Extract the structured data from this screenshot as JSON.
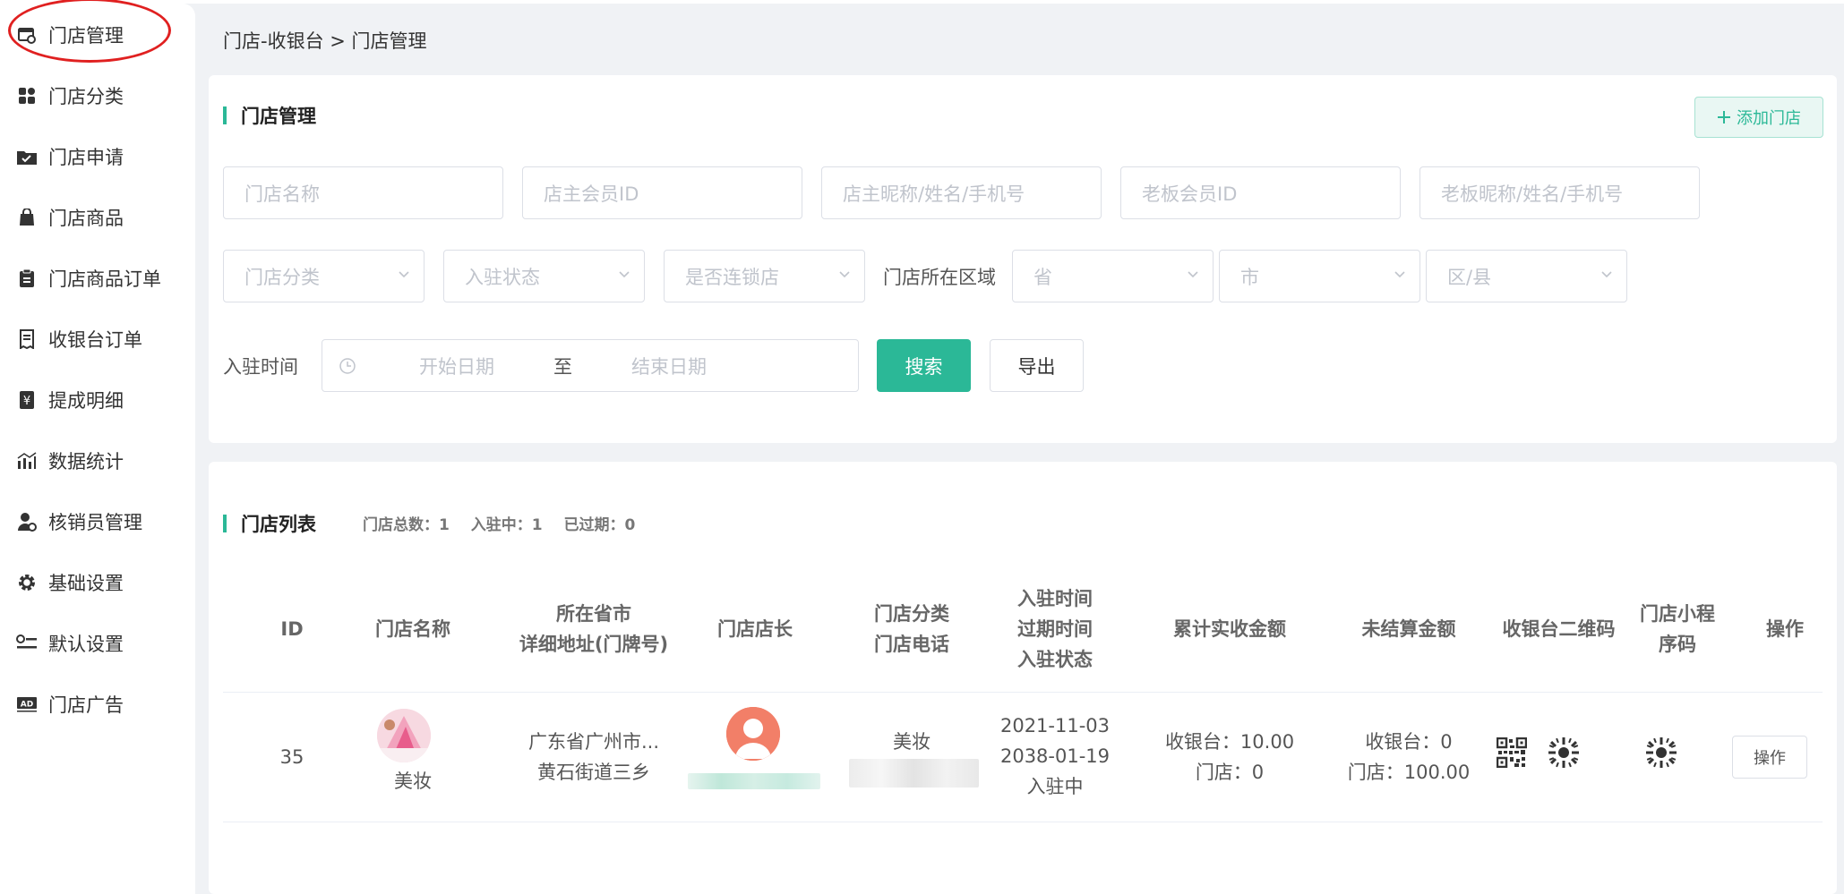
{
  "sidebar": {
    "items": [
      {
        "label": "门店管理",
        "icon": "store-icon"
      },
      {
        "label": "门店分类",
        "icon": "category-icon"
      },
      {
        "label": "门店申请",
        "icon": "application-icon"
      },
      {
        "label": "门店商品",
        "icon": "shopping-bag-icon"
      },
      {
        "label": "门店商品订单",
        "icon": "clipboard-icon"
      },
      {
        "label": "收银台订单",
        "icon": "receipt-icon"
      },
      {
        "label": "提成明细",
        "icon": "yen-icon"
      },
      {
        "label": "数据统计",
        "icon": "statistics-icon"
      },
      {
        "label": "核销员管理",
        "icon": "user-manage-icon"
      },
      {
        "label": "基础设置",
        "icon": "gear-icon"
      },
      {
        "label": "默认设置",
        "icon": "default-settings-icon"
      },
      {
        "label": "门店广告",
        "icon": "ad-icon"
      }
    ],
    "highlight_color": "#e02020"
  },
  "breadcrumb": "门店-收银台 > 门店管理",
  "filter": {
    "title": "门店管理",
    "add_button": "添加门店",
    "add_icon": "plus-icon",
    "inputs": {
      "store_name": "门店名称",
      "owner_member_id": "店主会员ID",
      "owner_name": "店主昵称/姓名/手机号",
      "boss_member_id": "老板会员ID",
      "boss_name": "老板昵称/姓名/手机号"
    },
    "selects": {
      "category": "门店分类",
      "status": "入驻状态",
      "chain": "是否连锁店",
      "province": "省",
      "city": "市",
      "district": "区/县"
    },
    "region_label": "门店所在区域",
    "time_label": "入驻时间",
    "start_date": "开始日期",
    "date_sep": "至",
    "end_date": "结束日期",
    "search": "搜索",
    "export": "导出"
  },
  "list": {
    "title": "门店列表",
    "stats": {
      "total": "门店总数：1",
      "active": "入驻中：1",
      "expired": "已过期：0"
    },
    "headers": {
      "id": "ID",
      "name": "门店名称",
      "region1": "所在省市",
      "region2": "详细地址(门牌号)",
      "manager": "门店店长",
      "cat1": "门店分类",
      "cat2": "门店电话",
      "time1": "入驻时间",
      "time2": "过期时间",
      "time3": "入驻状态",
      "received": "累计实收金额",
      "unsettled": "未结算金额",
      "cashier_qr": "收银台二维码",
      "mini1": "门店小程",
      "mini2": "序码",
      "op": "操作"
    },
    "rows": [
      {
        "id": "35",
        "name": "美妆",
        "province_city": "广东省广州市...",
        "address": "黄石街道三乡",
        "category": "美妆",
        "join_time": "2021-11-03",
        "expire_time": "2038-01-19",
        "status": "入驻中",
        "received_cashier": "收银台：10.00",
        "received_store": "门店：0",
        "unsettled_cashier": "收银台：0",
        "unsettled_store": "门店：100.00",
        "op_button": "操作"
      }
    ]
  },
  "colors": {
    "accent": "#2bb897",
    "background": "#f0f2f5"
  }
}
